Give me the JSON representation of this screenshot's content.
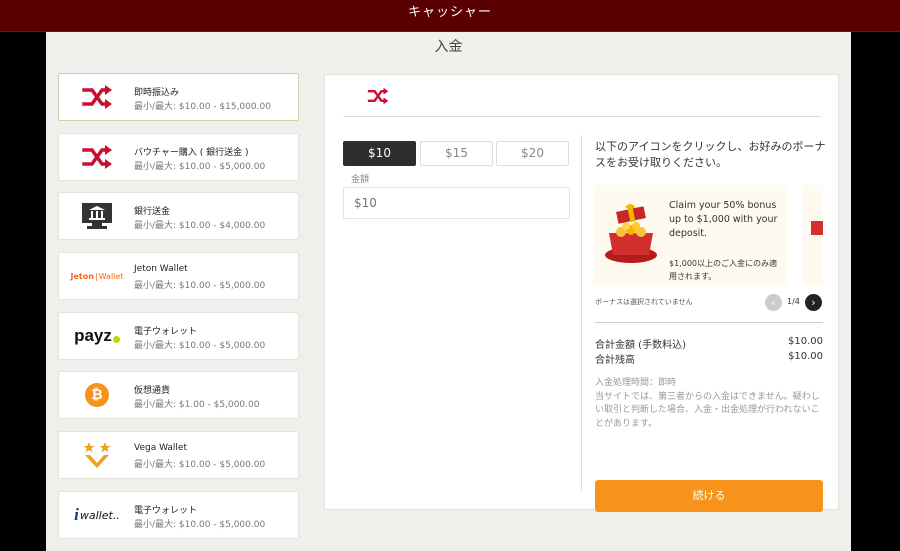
{
  "header": {
    "title": "キャッシャー"
  },
  "page": {
    "title": "入金"
  },
  "methods": [
    {
      "name": "即時振込み",
      "range": "最小/最大: $10.00 - $15,000.00",
      "logo": "shuffle-icon",
      "selected": true
    },
    {
      "name": "バウチャー購入 ( 銀行送金 )",
      "range": "最小/最大: $10.00 - $5,000.00",
      "logo": "shuffle-icon"
    },
    {
      "name": "銀行送金",
      "range": "最小/最大: $10.00 - $4,000.00",
      "logo": "bank-icon"
    },
    {
      "name": "Jeton Wallet",
      "range": "最小/最大: $10.00 - $5,000.00",
      "logo": "jeton-logo",
      "logo_text_a": "Jeton",
      "logo_text_b": "Wallet"
    },
    {
      "name": "電子ウォレット",
      "range": "最小/最大: $10.00 - $5,000.00",
      "logo": "payz-logo",
      "logo_text": "payz"
    },
    {
      "name": "仮想通貨",
      "range": "最小/最大: $1.00 - $5,000.00",
      "logo": "bitcoin-icon",
      "logo_text": "₿"
    },
    {
      "name": "Vega Wallet",
      "range": "最小/最大: $10.00 - $5,000.00",
      "logo": "vega-logo"
    },
    {
      "name": "電子ウォレット",
      "range": "最小/最大: $10.00 - $5,000.00",
      "logo": "iwallet-logo",
      "logo_text": "wallet.."
    }
  ],
  "amounts": {
    "options": [
      "$10",
      "$15",
      "$20"
    ],
    "selected_index": 0,
    "label": "金額",
    "value": "$10"
  },
  "bonus": {
    "title": "以下のアイコンをクリックし、お好みのボーナスをお受け取りください。",
    "card_text": "Claim your 50% bonus up to $1,000 with your deposit.",
    "card_note": "$1,000以上のご入金にのみ適用されます。",
    "status": "ボーナスは選択されていません",
    "pager": "1/4"
  },
  "summary": {
    "total_label": "合計金額 (手数料込)",
    "total_value": "$10.00",
    "balance_label": "合計残高",
    "balance_value": "$10.00"
  },
  "info": {
    "time": "入金処理時間：即時",
    "note": "当サイトでは、第三者からの入金はできません。疑わしい取引と判断した場合、入金・出金処理が行われないことがあります。"
  },
  "continue_label": "続ける",
  "colors": {
    "header": "#5a0000",
    "accent": "#f7931a",
    "shuffle": "#c8102e"
  }
}
